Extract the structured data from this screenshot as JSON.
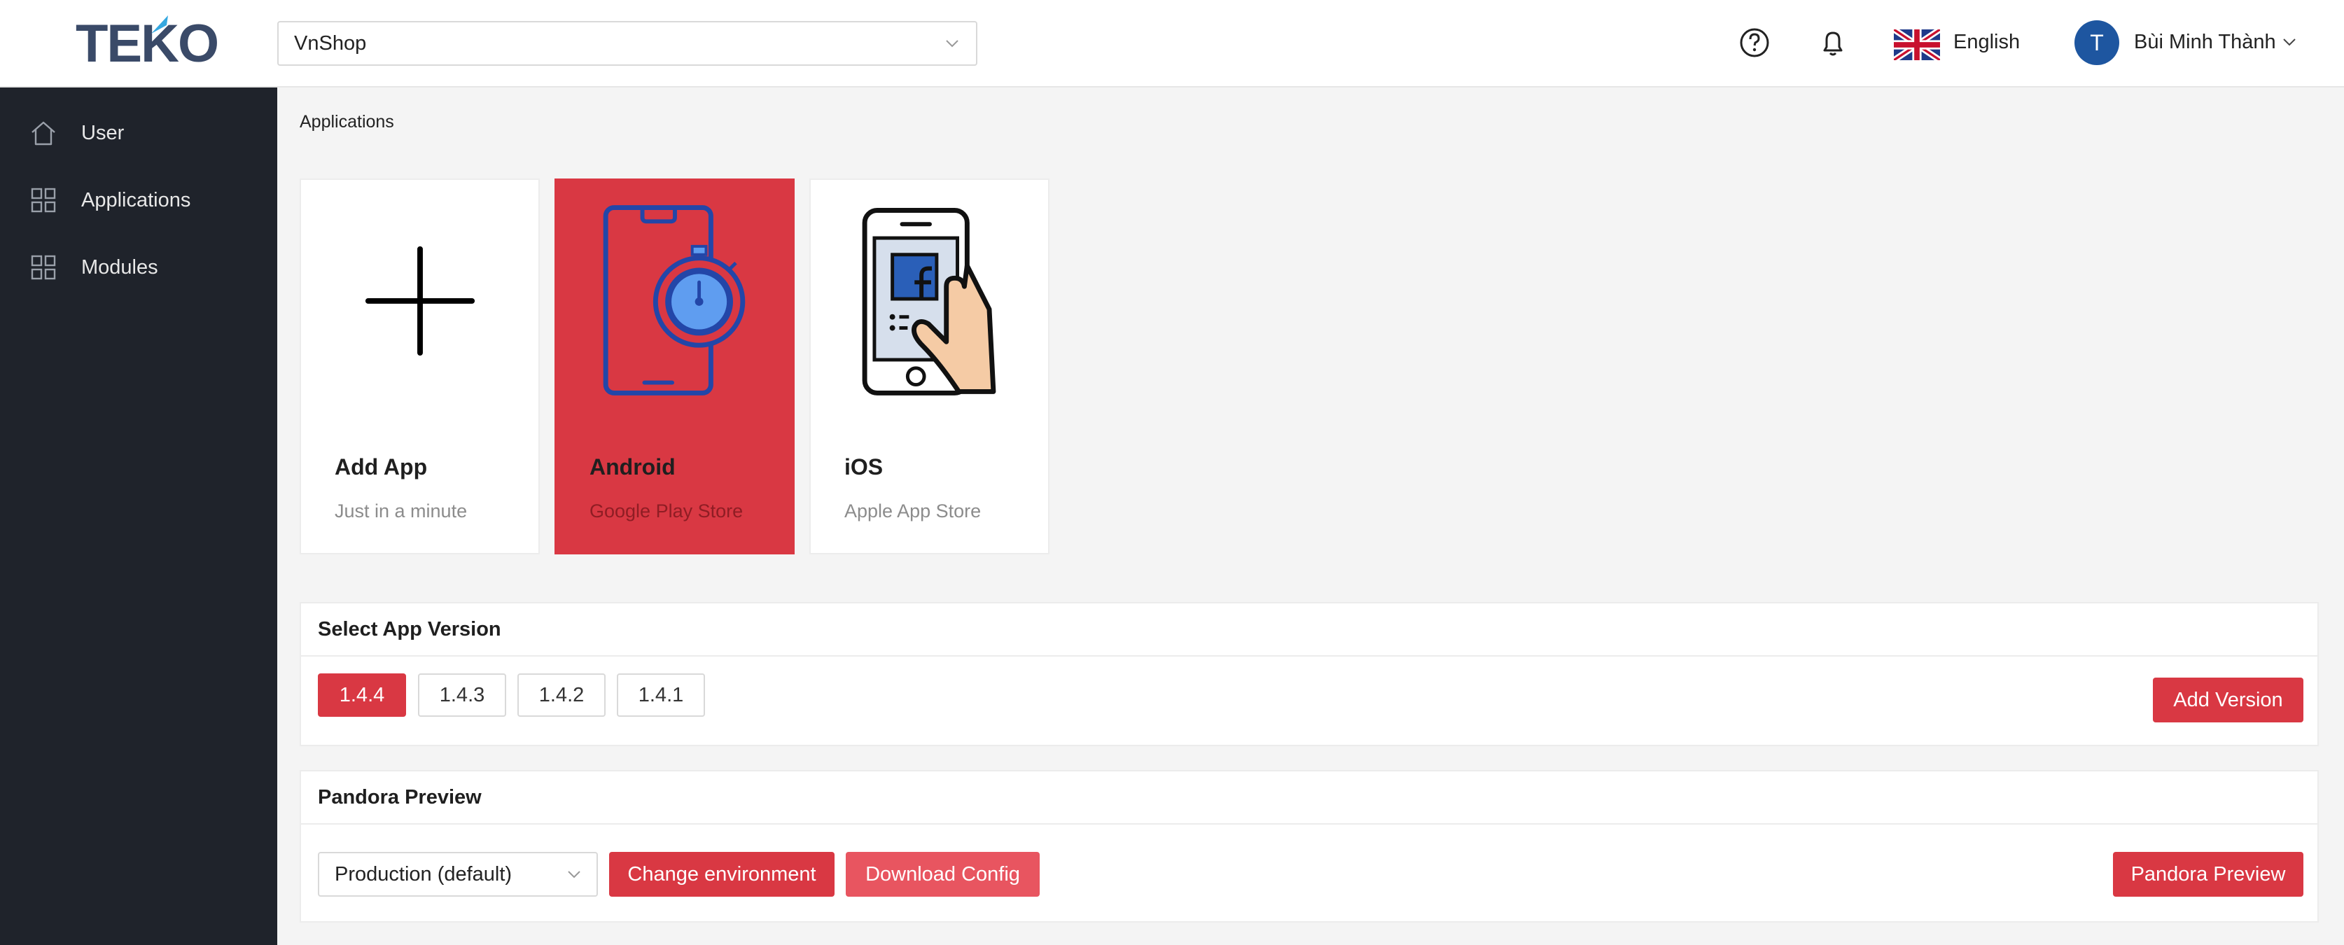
{
  "header": {
    "logo_text": "TEKO",
    "shop_selector_value": "VnShop",
    "language_label": "English",
    "user": {
      "avatar_initial": "T",
      "name": "Bùi Minh Thành"
    }
  },
  "sidebar": {
    "items": [
      {
        "label": "User",
        "icon": "home-icon"
      },
      {
        "label": "Applications",
        "icon": "grid-icon"
      },
      {
        "label": "Modules",
        "icon": "grid-icon"
      }
    ]
  },
  "breadcrumb": "Applications",
  "cards": [
    {
      "title": "Add App",
      "subtitle": "Just in a minute",
      "icon": "plus-icon",
      "selected": false
    },
    {
      "title": "Android",
      "subtitle": "Google Play Store",
      "icon": "android-phone-stopwatch-icon",
      "selected": true
    },
    {
      "title": "iOS",
      "subtitle": "Apple App Store",
      "icon": "iphone-hand-facebook-icon",
      "selected": false
    }
  ],
  "version_panel": {
    "title": "Select App Version",
    "versions": [
      "1.4.4",
      "1.4.3",
      "1.4.2",
      "1.4.1"
    ],
    "selected_version": "1.4.4",
    "add_button": "Add Version"
  },
  "pandora_panel": {
    "title": "Pandora Preview",
    "environment_value": "Production (default)",
    "change_env_button": "Change environment",
    "download_button": "Download Config",
    "preview_button": "Pandora Preview"
  },
  "colors": {
    "accent": "#d93843",
    "sidebar_bg": "#1f232b",
    "avatar_bg": "#1e56a0"
  }
}
